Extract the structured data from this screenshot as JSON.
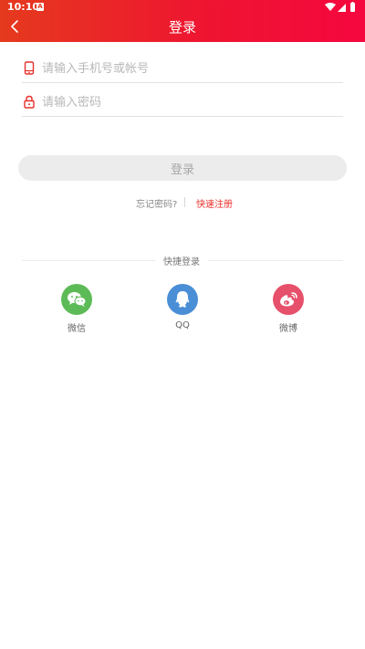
{
  "status_bar": {
    "time": "10:10",
    "app_icon_letter": "A"
  },
  "header": {
    "title": "登录"
  },
  "form": {
    "phone_placeholder": "请输入手机号或帐号",
    "password_placeholder": "请输入密码",
    "login_button": "登录"
  },
  "links": {
    "forgot_password": "忘记密码?",
    "quick_register": "快速注册"
  },
  "quick_login": {
    "title": "快捷登录",
    "options": [
      {
        "label": "微信",
        "icon": "wechat-icon",
        "color": "#5dbb57"
      },
      {
        "label": "QQ",
        "icon": "qq-icon",
        "color": "#4a8ed6"
      },
      {
        "label": "微博",
        "icon": "weibo-icon",
        "color": "#e7506a"
      }
    ]
  },
  "colors": {
    "header_start": "#e53a1e",
    "header_end": "#f5073f",
    "accent": "#e8312b"
  }
}
